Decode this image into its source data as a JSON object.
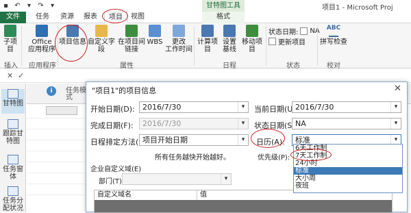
{
  "window": {
    "context_tab_group": "甘特图工具",
    "title": "项目1 - Microsoft Proj"
  },
  "ribbon_tabs": [
    {
      "label": "文件"
    },
    {
      "label": "任务"
    },
    {
      "label": "资源"
    },
    {
      "label": "报表"
    },
    {
      "label": "项目"
    },
    {
      "label": "视图"
    },
    {
      "label": "格式"
    }
  ],
  "ribbon": {
    "buttons": {
      "subproject": "子项目",
      "office_apps_1": "Office",
      "office_apps_2": "应用程序",
      "project_info": "项目信息",
      "custom_fields": "自定义字段",
      "links_1": "在项目间",
      "links_2": "链接",
      "wbs": "WBS",
      "change_time_1": "更改",
      "change_time_2": "工作时间",
      "calc_project": "计算项目",
      "set_baseline_1": "设置",
      "set_baseline_2": "基线",
      "move_project": "移动项目",
      "status_date_label": "状态日期:",
      "status_date_value": "NA",
      "update_project": "更新项目",
      "spelling": "拼写检查",
      "spelling_abc": "ABC"
    },
    "groups": {
      "insert": "插入",
      "apps": "应用程序",
      "properties": "属性",
      "schedule": "日程",
      "status": "状态",
      "proofing": "校对"
    }
  },
  "viewbar": {
    "items": [
      {
        "label": "甘特图"
      },
      {
        "label": "跟踪甘特图"
      },
      {
        "label": "任务窗体"
      },
      {
        "label": "任务分配状况"
      }
    ]
  },
  "grid": {
    "task_name_header": "任务模式"
  },
  "dialog": {
    "title": "\"项目1\"的项目信息",
    "start_date_label": "开始日期(D):",
    "start_date_value": "2016/7/30",
    "current_date_label": "当前日期(U):",
    "current_date_value": "2016/7/30",
    "finish_date_label": "完成日期(F):",
    "finish_date_value": "2016/7/30",
    "status_date_label": "状态日期(S):",
    "status_date_value": "NA",
    "schedule_from_label": "日程排定方法(L):",
    "schedule_from_value": "项目开始日期",
    "calendar_label": "日历(A):",
    "calendar_value": "标准",
    "schedule_note": "所有任务越快开始越好。",
    "priority_label": "优先级(P):",
    "enterprise_fields_label": "企业自定义域(E)",
    "department_label": "部门(T):",
    "table_col_field": "自定义域名",
    "table_col_value": "值",
    "calendar_options": [
      "6天工作制",
      "7天工作制",
      "24小时",
      "标准",
      "大小周",
      "夜班"
    ],
    "calendar_selected_index": 3
  }
}
